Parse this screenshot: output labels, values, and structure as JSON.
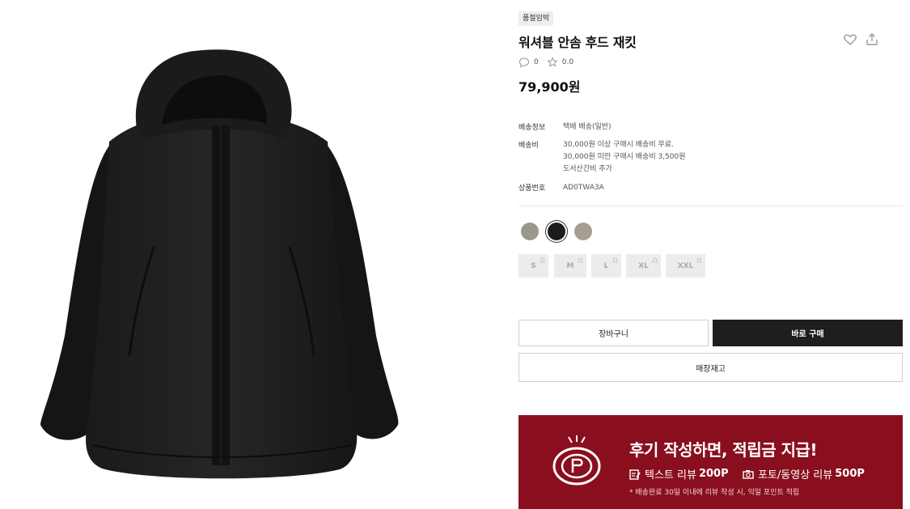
{
  "product": {
    "badge": "품절임박",
    "title": "워셔블 안솜 후드 재킷",
    "review_count": "0",
    "rating": "0.0",
    "price": "79,900원"
  },
  "details": {
    "shipping_label": "배송정보",
    "shipping_value": "택배 배송(일반)",
    "fee_label": "배송비",
    "fee_line1": "30,000원 이상 구매시 배송비 무료.",
    "fee_line2": "30,000원 미만 구매시 배송비 3,500원",
    "fee_line3": "도서산간비 추가",
    "code_label": "상품번호",
    "code_value": "AD0TWA3A"
  },
  "colors": [
    {
      "hex": "#9a978d"
    },
    {
      "hex": "#1c1c1c"
    },
    {
      "hex": "#a69d93"
    }
  ],
  "sizes": [
    "S",
    "M",
    "L",
    "XL",
    "XXL"
  ],
  "buttons": {
    "cart": "장바구니",
    "buy": "바로 구매",
    "stock": "매장재고"
  },
  "banner": {
    "title": "후기 작성하면, 적립금 지급!",
    "text_review_label": "텍스트 리뷰",
    "text_review_points": "200P",
    "photo_review_label": "포토/동영상 리뷰",
    "photo_review_points": "500P",
    "note": "* 배송완료 30일 이내에 리뷰 작성 시, 익일 포인트 적립"
  },
  "theme": {
    "banner_color": "#8a0f1e",
    "primary_button": "#1e1e1e"
  }
}
